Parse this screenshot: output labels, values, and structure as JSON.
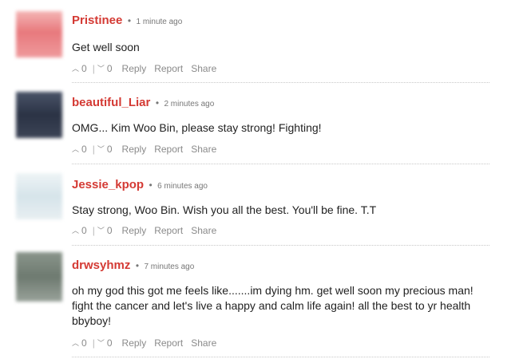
{
  "comments": [
    {
      "username": "Pristinee",
      "time": "1 minute ago",
      "text": "Get well soon",
      "upvotes": "0",
      "downvotes": "0",
      "avatar_color": "#e8797d"
    },
    {
      "username": "beautiful_Liar",
      "time": "2 minutes ago",
      "text": "OMG... Kim Woo Bin, please stay strong! Fighting!",
      "upvotes": "0",
      "downvotes": "0",
      "avatar_color": "#2b3345"
    },
    {
      "username": "Jessie_kpop",
      "time": "6 minutes ago",
      "text": "Stay strong, Woo Bin. Wish you all the best. You'll be fine. T.T",
      "upvotes": "0",
      "downvotes": "0",
      "avatar_color": "#d6e4ea"
    },
    {
      "username": "drwsyhmz",
      "time": "7 minutes ago",
      "text": "oh my god this got me feels like.......im dying hm. get well soon my precious man! fight the cancer and let's live a happy and calm life again! all the best to yr health bbyboy!",
      "upvotes": "0",
      "downvotes": "0",
      "avatar_color": "#6e7a70"
    }
  ],
  "actions": {
    "bullet": "•",
    "upvote_icon": "︿",
    "downvote_icon": "﹀",
    "separator": "|",
    "reply": "Reply",
    "report": "Report",
    "share": "Share"
  }
}
